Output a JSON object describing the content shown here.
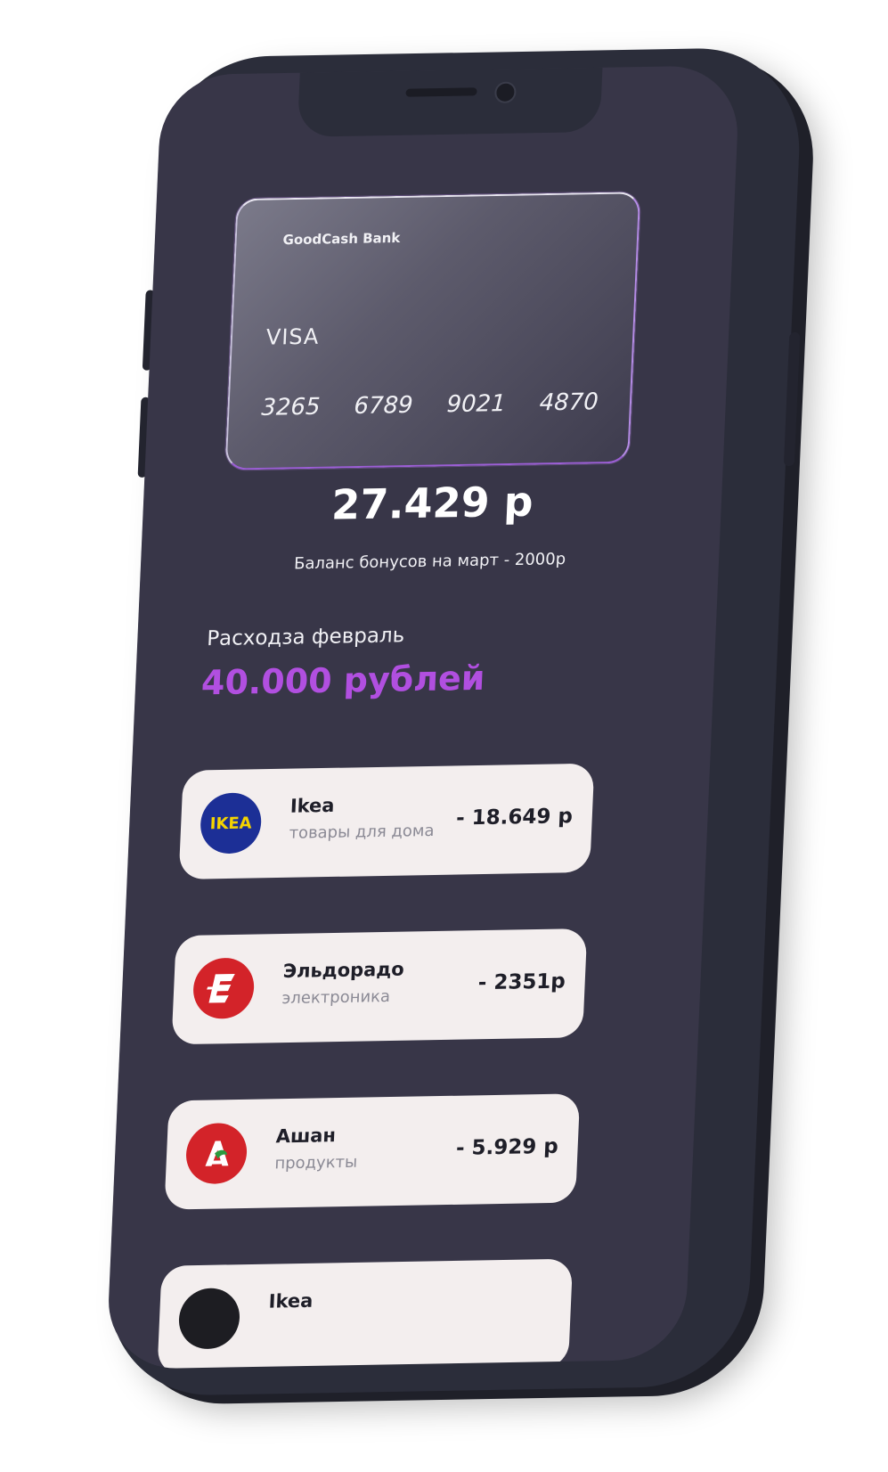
{
  "card": {
    "bank_name": "GoodCash Bank",
    "brand": "VISA",
    "number_groups": [
      "3265",
      "6789",
      "9021",
      "4870"
    ]
  },
  "balance": {
    "amount": "27.429 р",
    "bonus_text": "Баланс бонусов на март - 2000р"
  },
  "spending": {
    "label": "Расходза февраль",
    "amount": "40.000 рублей"
  },
  "transactions": [
    {
      "name": "Ikea",
      "category": "товары для дома",
      "amount": "- 18.649 р",
      "logo_text": "IKEA",
      "logo_color": "#1c2f96"
    },
    {
      "name": "Эльдорадо",
      "category": "электроника",
      "amount": "- 2351р",
      "logo_icon": "eldorado-logo-icon",
      "logo_color": "#d32329"
    },
    {
      "name": "Ашан",
      "category": "продукты",
      "amount": "- 5.929 р",
      "logo_icon": "auchan-logo-icon",
      "logo_color": "#d32329"
    },
    {
      "name": "Ikea",
      "logo_color": "#1d1d22"
    }
  ],
  "colors": {
    "screen_bg": "#383648",
    "accent_purple": "#b14fe0",
    "tx_bg": "#f3eeee",
    "phone_frame": "#2b2d3a"
  }
}
